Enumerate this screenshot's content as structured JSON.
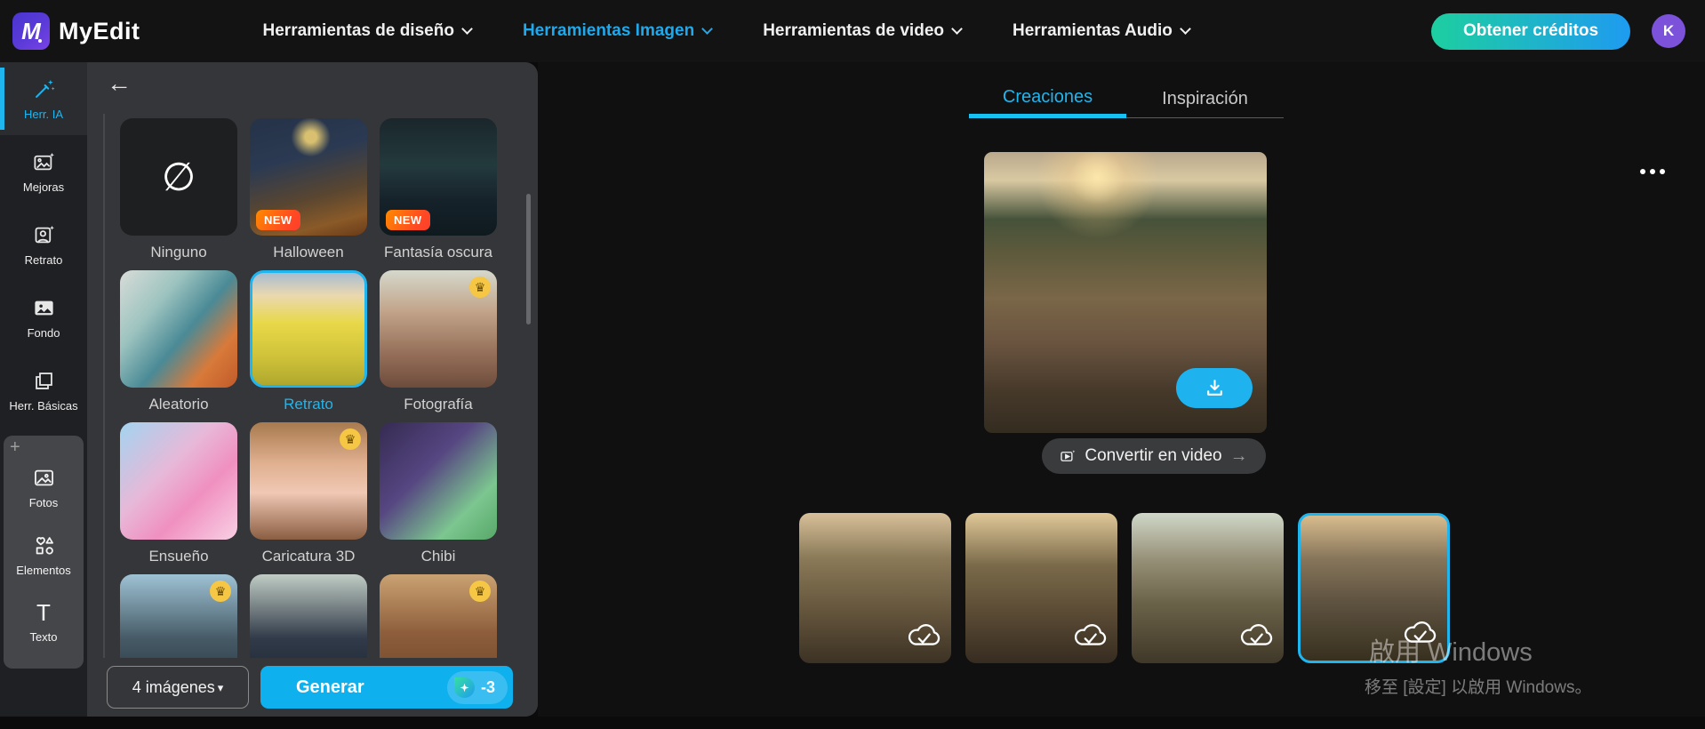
{
  "header": {
    "app_name": "MyEdit",
    "logo_letter": "M",
    "nav_items": [
      {
        "label": "Herramientas de diseño",
        "active": false
      },
      {
        "label": "Herramientas Imagen",
        "active": true
      },
      {
        "label": "Herramientas de video",
        "active": false
      },
      {
        "label": "Herramientas Audio",
        "active": false
      }
    ],
    "credits_button_label": "Obtener créditos",
    "avatar_initial": "K"
  },
  "sidebar": {
    "tools": [
      {
        "label": "Herr. IA",
        "icon": "magic-wand-icon",
        "active": true
      },
      {
        "label": "Mejoras",
        "icon": "image-sparkle-icon",
        "active": false
      },
      {
        "label": "Retrato",
        "icon": "portrait-sparkle-icon",
        "active": false
      },
      {
        "label": "Fondo",
        "icon": "background-image-icon",
        "active": false
      },
      {
        "label": "Herr. Básicas",
        "icon": "overlap-squares-icon",
        "active": false
      }
    ],
    "library": [
      {
        "label": "Fotos",
        "icon": "photo-icon"
      },
      {
        "label": "Elementos",
        "icon": "shapes-icon"
      },
      {
        "label": "Texto",
        "icon": "text-icon"
      }
    ]
  },
  "style_panel": {
    "styles": [
      {
        "label": "Ninguno",
        "selected": false
      },
      {
        "label": "Halloween",
        "badge": "NEW"
      },
      {
        "label": "Fantasía oscura",
        "badge": "NEW"
      },
      {
        "label": "Aleatorio"
      },
      {
        "label": "Retrato",
        "selected": true
      },
      {
        "label": "Fotografía",
        "premium": true
      },
      {
        "label": "Ensueño"
      },
      {
        "label": "Caricatura 3D",
        "premium": true
      },
      {
        "label": "Chibi"
      }
    ],
    "image_count_label": "4 imágenes",
    "generate_label": "Generar",
    "credit_cost": "-3"
  },
  "content": {
    "tabs": [
      {
        "label": "Creaciones",
        "active": true
      },
      {
        "label": "Inspiración",
        "active": false
      }
    ],
    "convert_button_label": "Convertir en video",
    "thumbnail_count": 4,
    "selected_thumbnail_index": 3
  },
  "watermark": {
    "line1": "啟用 Windows",
    "line2": "移至 [設定] 以啟用 Windows。"
  },
  "icons": {
    "crown": "♛",
    "caret_down": "▾",
    "none_symbol": "∅",
    "back": "←",
    "arrow_right": "→",
    "plus": "+"
  },
  "colors": {
    "accent": "#1FB6F0",
    "generate_button": "#0FB0EE",
    "credits_gradient": [
      "#1DCFA0",
      "#1E9BF0"
    ],
    "new_badge_gradient": [
      "#FF8A00",
      "#FF3D2E"
    ],
    "premium_badge": "#F6C645",
    "avatar": "#7B52D9"
  }
}
